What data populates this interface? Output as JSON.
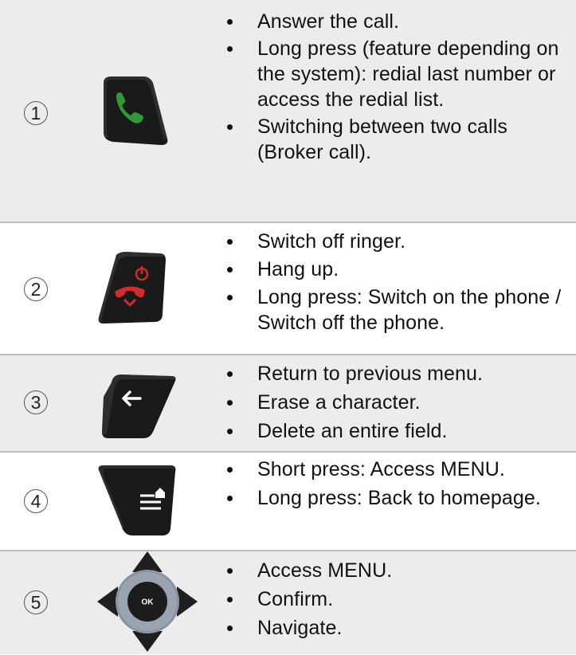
{
  "rows": [
    {
      "number": "1",
      "key_icon": "call-answer-key-icon",
      "bullets": [
        "Answer the call.",
        "Long press (feature depending on the system): redial last number or access the redial list.",
        "Switching between two calls (Broker call)."
      ]
    },
    {
      "number": "2",
      "key_icon": "hang-up-power-key-icon",
      "bullets": [
        "Switch off ringer.",
        "Hang up.",
        "Long press: Switch on the phone / Switch off the phone."
      ]
    },
    {
      "number": "3",
      "key_icon": "back-arrow-key-icon",
      "bullets": [
        "Return to previous menu.",
        "Erase a character.",
        "Delete an entire field."
      ]
    },
    {
      "number": "4",
      "key_icon": "menu-home-key-icon",
      "bullets": [
        "Short press: Access MENU.",
        "Long press: Back to homepage."
      ]
    },
    {
      "number": "5",
      "key_icon": "navigation-ok-pad-icon",
      "ok_label": "OK",
      "bullets": [
        "Access MENU.",
        "Confirm.",
        "Navigate."
      ]
    }
  ],
  "colors": {
    "row_shade": "#ececec",
    "divider": "#bdbdbd",
    "key_body": "#1a1a1a",
    "call_green": "#2e9a3a",
    "hangup_red": "#d42a2a",
    "navpad_ring": "#8a93a0"
  }
}
